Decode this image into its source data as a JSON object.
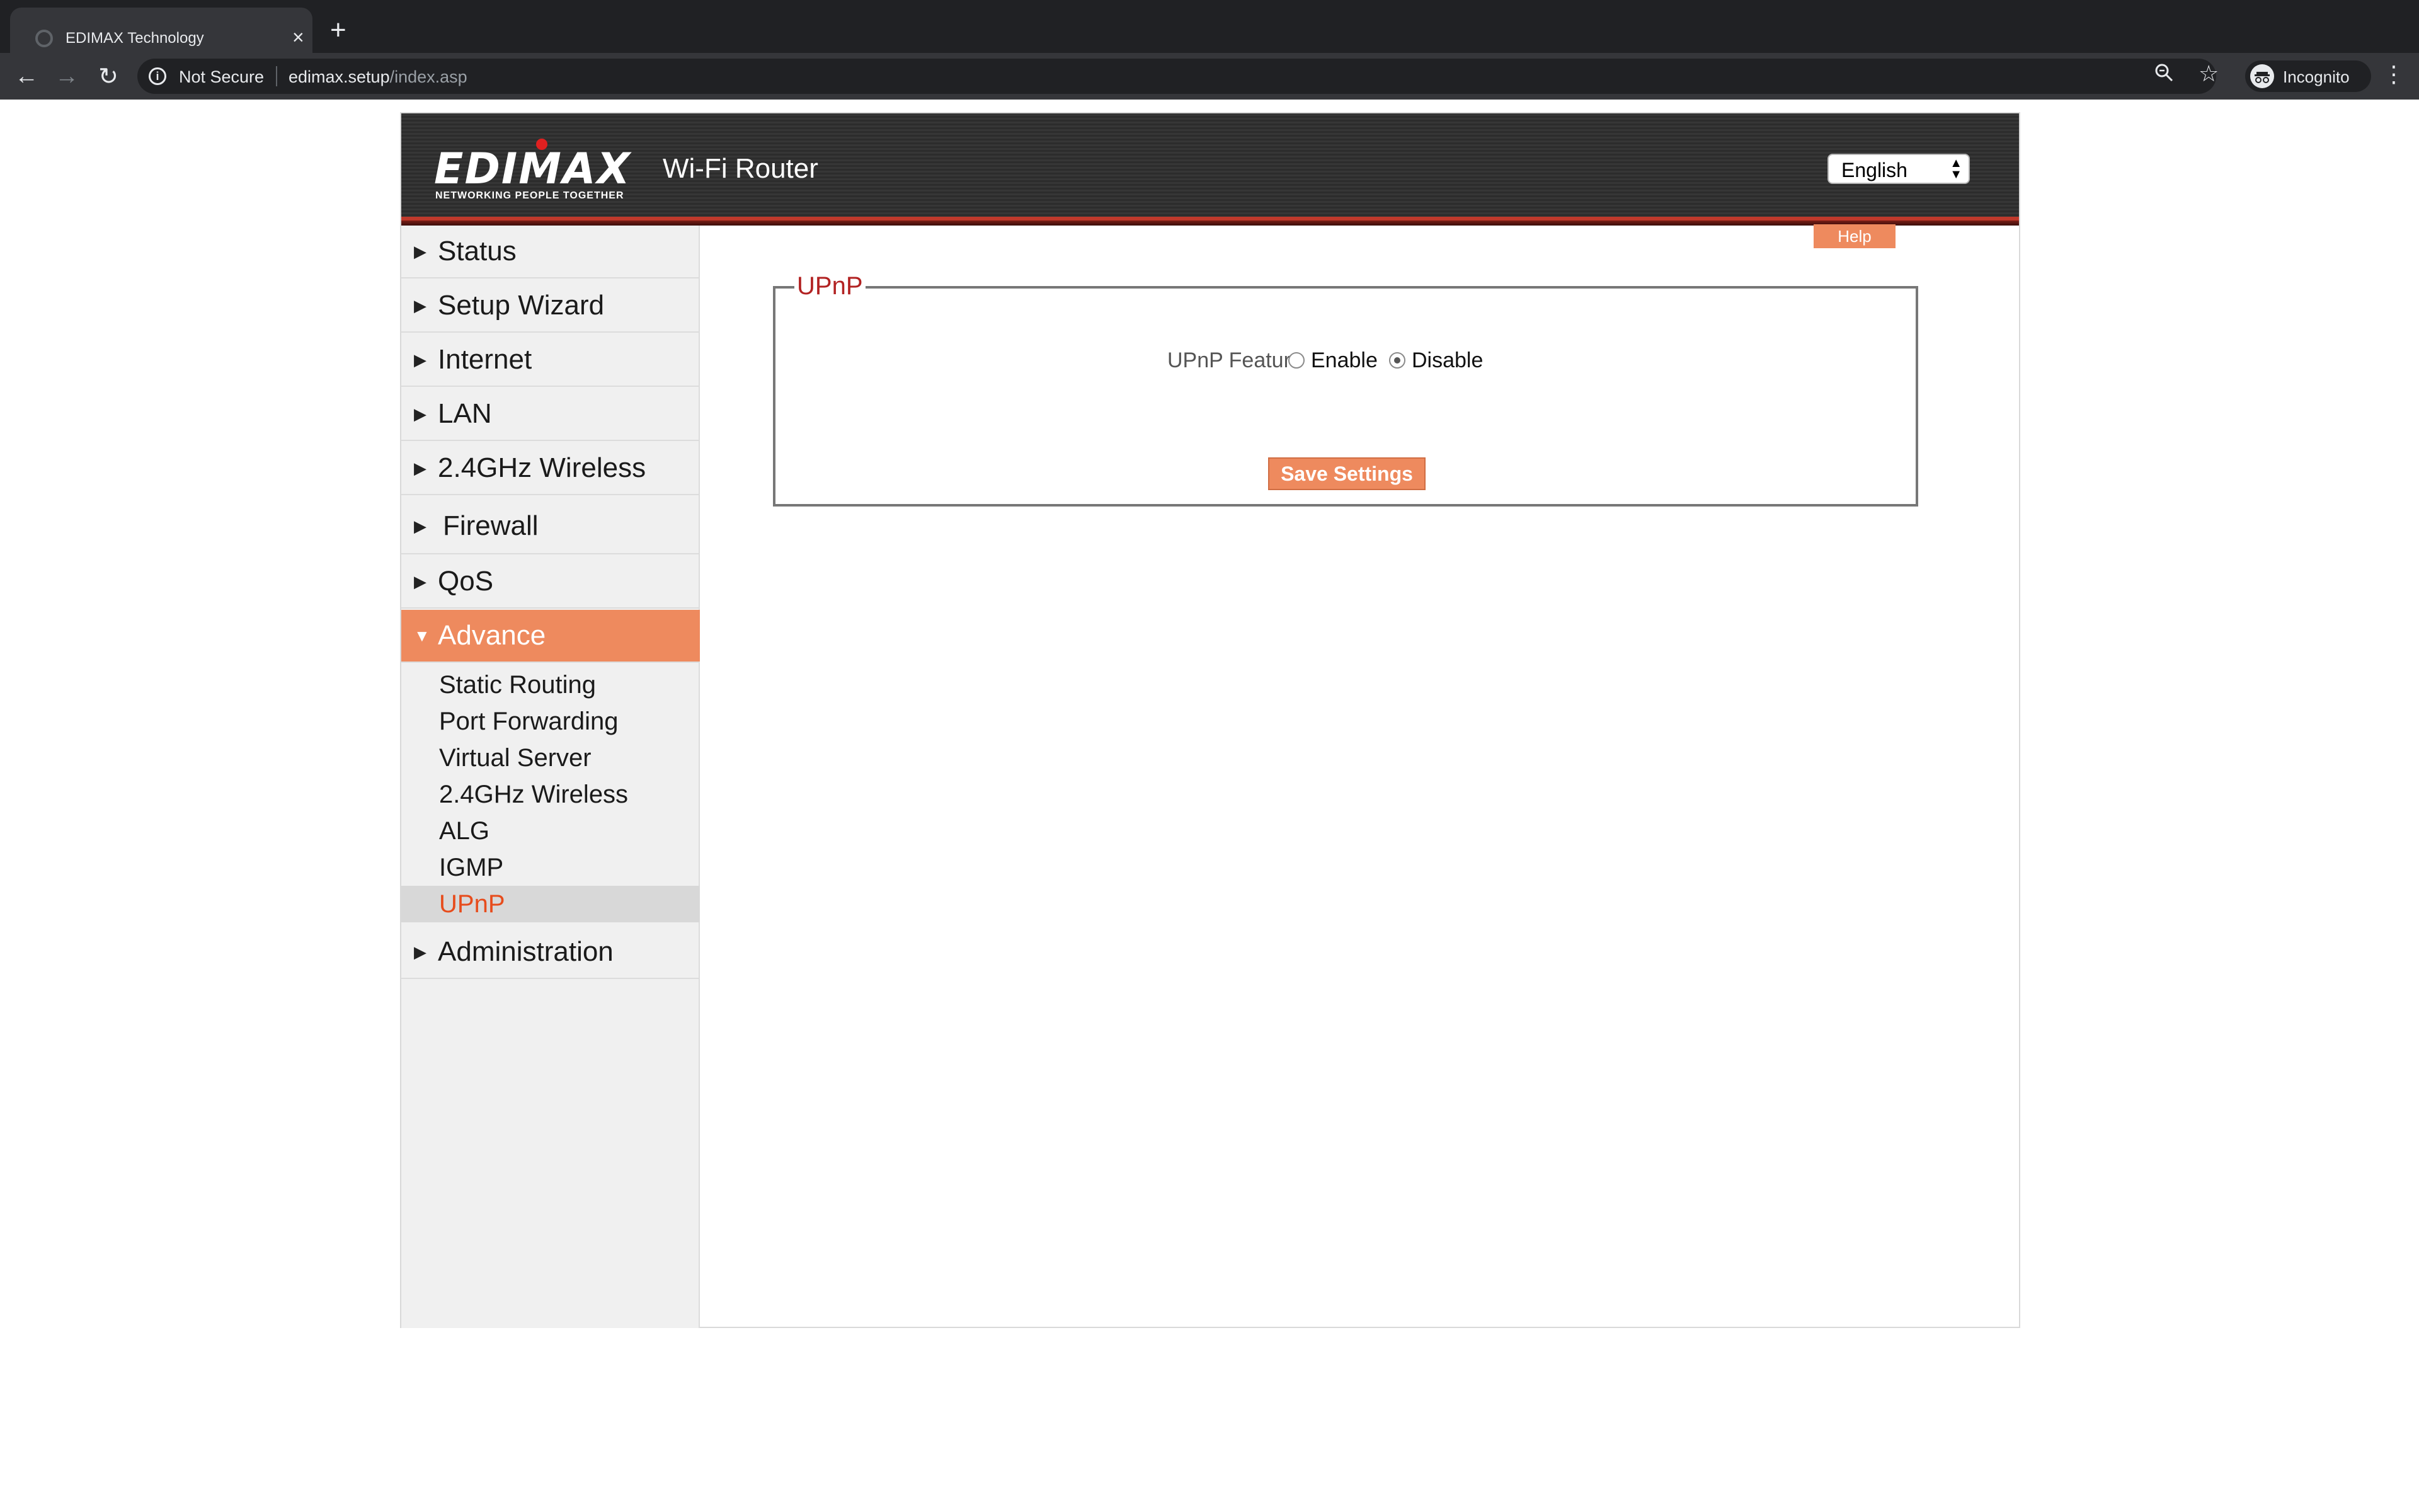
{
  "browser": {
    "tab_title": "EDIMAX Technology",
    "tab_close": "×",
    "new_tab": "+",
    "security_label": "Not Secure",
    "url_host": "edimax.setup",
    "url_path": "/index.asp",
    "profile_label": "Incognito",
    "icons": [
      "back-icon",
      "forward-icon",
      "reload-icon",
      "info-icon",
      "zoom-icon",
      "star-icon",
      "incognito-icon",
      "menu-icon"
    ]
  },
  "header": {
    "logo_text": "EDIMAX",
    "logo_tagline": "NETWORKING PEOPLE TOGETHER",
    "product_name": "Wi-Fi Router",
    "language": "English"
  },
  "sidebar": {
    "items": [
      {
        "label": "Status",
        "arrow": "▶"
      },
      {
        "label": "Setup Wizard",
        "arrow": "▶"
      },
      {
        "label": "Internet",
        "arrow": "▶"
      },
      {
        "label": "LAN",
        "arrow": "▶"
      },
      {
        "label": "2.4GHz Wireless",
        "arrow": "▶"
      },
      {
        "label": "Firewall",
        "arrow": "▶"
      },
      {
        "label": "QoS",
        "arrow": "▶"
      },
      {
        "label": "Advance",
        "arrow": "▼"
      },
      {
        "label": "Administration",
        "arrow": "▶"
      }
    ],
    "advance_sub_items": [
      {
        "label": "Static Routing"
      },
      {
        "label": "Port Forwarding"
      },
      {
        "label": "Virtual Server"
      },
      {
        "label": "2.4GHz Wireless"
      },
      {
        "label": "ALG"
      },
      {
        "label": "IGMP"
      },
      {
        "label": "UPnP"
      }
    ],
    "active_item": "Advance",
    "selected_sub_item": "UPnP"
  },
  "main": {
    "help_label": "Help",
    "section_title": "UPnP",
    "feature_label": "UPnP Feature",
    "options": [
      {
        "label": "Enable",
        "checked": false
      },
      {
        "label": "Disable",
        "checked": true
      }
    ],
    "save_label": "Save Settings"
  },
  "colors": {
    "accent": "#ee8a5e",
    "section_title": "#b22222",
    "selected_sub_item": "#e74c1c",
    "header_bg": "#2f2f2f"
  }
}
